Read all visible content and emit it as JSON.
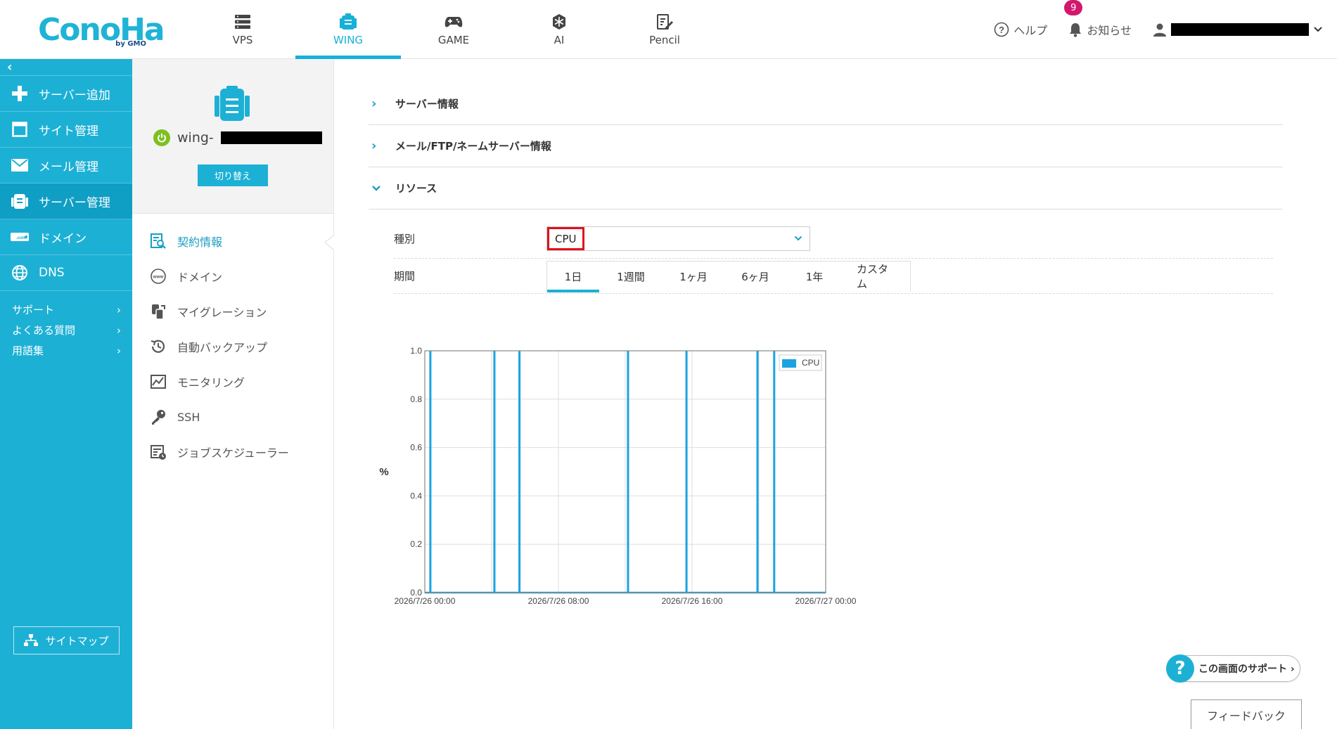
{
  "header": {
    "logo": "ConoHa",
    "logo_sub": "by GMO",
    "services": [
      {
        "label": "VPS",
        "icon": "server-stack-icon",
        "active": false
      },
      {
        "label": "WING",
        "icon": "wing-server-icon",
        "active": true
      },
      {
        "label": "GAME",
        "icon": "gamepad-icon",
        "active": false
      },
      {
        "label": "AI",
        "icon": "ai-chip-icon",
        "active": false
      },
      {
        "label": "Pencil",
        "icon": "pencil-doc-icon",
        "active": false
      }
    ],
    "help_label": "ヘルプ",
    "notice_label": "お知らせ",
    "notice_count": "9"
  },
  "sidebar": {
    "collapse_glyph": "‹",
    "items": [
      {
        "label": "サーバー追加",
        "icon": "plus-icon"
      },
      {
        "label": "サイト管理",
        "icon": "window-icon"
      },
      {
        "label": "メール管理",
        "icon": "mail-icon"
      },
      {
        "label": "サーバー管理",
        "icon": "server-icon",
        "active": true
      },
      {
        "label": "ドメイン",
        "icon": "domain-tag-icon"
      },
      {
        "label": "DNS",
        "icon": "globe-icon"
      }
    ],
    "links": [
      {
        "label": "サポート"
      },
      {
        "label": "よくある質問"
      },
      {
        "label": "用語集"
      }
    ],
    "sitemap_label": "サイトマップ"
  },
  "server_card": {
    "name_prefix": "wing-",
    "switch_label": "切り替え"
  },
  "submenu": {
    "items": [
      {
        "label": "契約情報",
        "icon": "contract-search-icon",
        "active": true
      },
      {
        "label": "ドメイン",
        "icon": "www-icon"
      },
      {
        "label": "マイグレーション",
        "icon": "migration-icon"
      },
      {
        "label": "自動バックアップ",
        "icon": "backup-clock-icon"
      },
      {
        "label": "モニタリング",
        "icon": "monitoring-chart-icon"
      },
      {
        "label": "SSH",
        "icon": "key-icon"
      },
      {
        "label": "ジョブスケジューラー",
        "icon": "scheduler-icon"
      }
    ]
  },
  "main": {
    "sections": [
      {
        "label": "サーバー情報",
        "expanded": false
      },
      {
        "label": "メール/FTP/ネームサーバー情報",
        "expanded": false
      },
      {
        "label": "リソース",
        "expanded": true
      }
    ],
    "type_label": "種別",
    "type_value": "CPU",
    "period_label": "期間",
    "period_tabs": [
      {
        "label": "1日",
        "active": true
      },
      {
        "label": "1週間"
      },
      {
        "label": "1ヶ月"
      },
      {
        "label": "6ヶ月"
      },
      {
        "label": "1年"
      },
      {
        "label": "カスタム"
      }
    ],
    "support_label": "この画面のサポート ›",
    "feedback_label": "フィードバック"
  },
  "colors": {
    "brand": "#1db0d5",
    "active_nav": "#0f9ec4",
    "series": "#1aa3e0",
    "highlight": "#e0101c",
    "badge": "#d2186c"
  },
  "chart_data": {
    "type": "line",
    "ylabel": "%",
    "ylim": [
      0,
      1.0
    ],
    "yticks": [
      "0.0",
      "0.2",
      "0.4",
      "0.6",
      "0.8",
      "1.0"
    ],
    "xlim": [
      "2026/7/26 00:00",
      "2026/7/27 00:00"
    ],
    "xtick_labels": [
      "2026/7/26 00:00",
      "2026/7/26 08:00",
      "2026/7/26 16:00",
      "2026/7/27 00:00"
    ],
    "grid": true,
    "legend_position": "top-right",
    "series": [
      {
        "name": "CPU",
        "color": "#1aa3e0",
        "spikes_at": [
          "2026/7/26 00:20",
          "2026/7/26 04:10",
          "2026/7/26 05:40",
          "2026/7/26 12:10",
          "2026/7/26 15:40",
          "2026/7/26 19:55",
          "2026/7/26 20:55"
        ],
        "spike_value": 1.0,
        "baseline": 0.0
      }
    ]
  }
}
